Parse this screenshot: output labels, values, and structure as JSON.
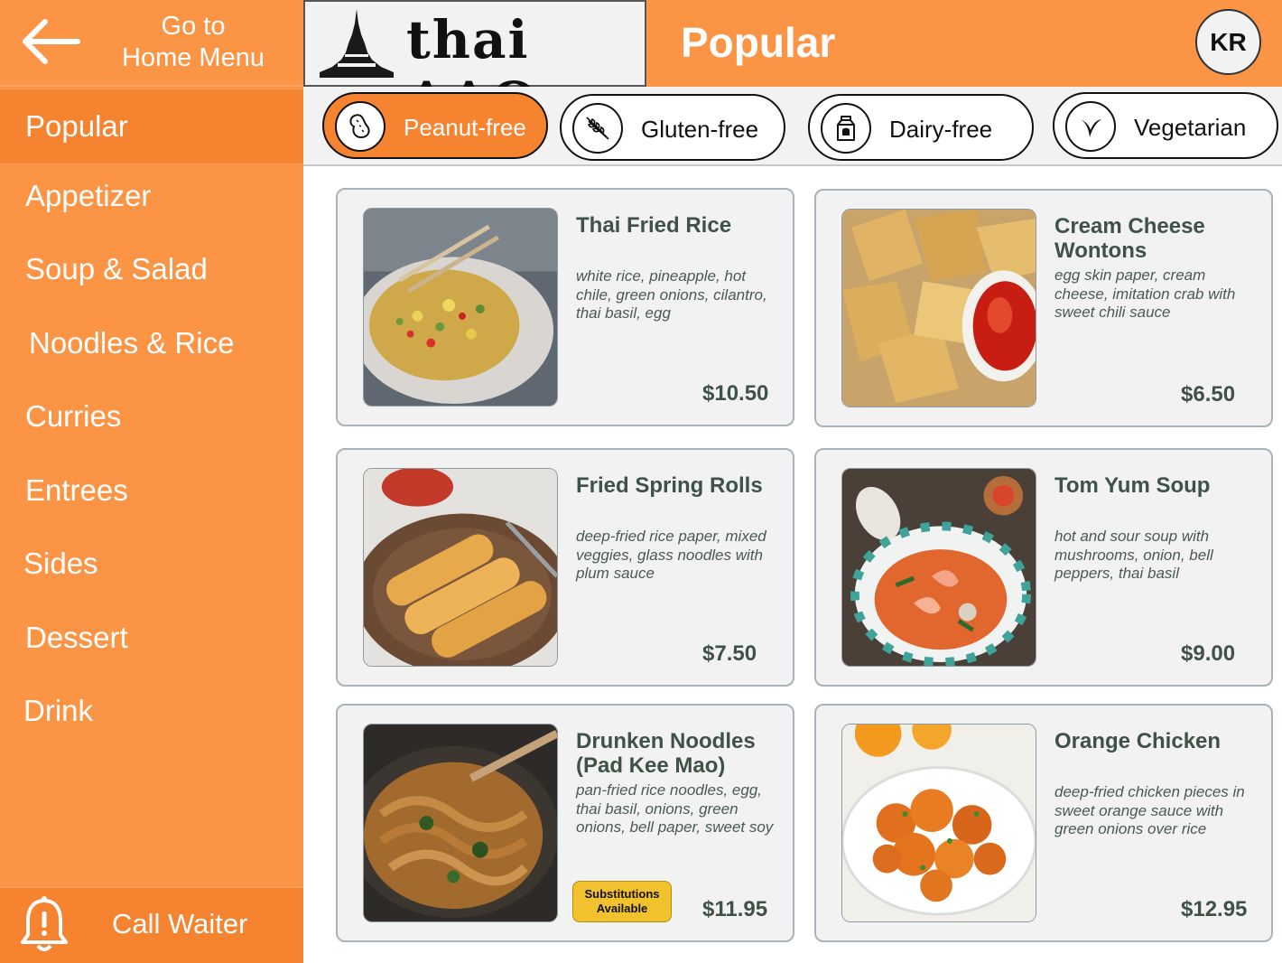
{
  "nav": {
    "back_label": "Go to\nHome Menu",
    "categories": [
      {
        "label": "Popular"
      },
      {
        "label": "Appetizer"
      },
      {
        "label": "Soup & Salad"
      },
      {
        "label": "Noodles & Rice"
      },
      {
        "label": "Curries"
      },
      {
        "label": "Entrees"
      },
      {
        "label": "Sides"
      },
      {
        "label": "Dessert"
      },
      {
        "label": "Drink"
      }
    ],
    "active_category": "Popular",
    "call_waiter_label": "Call Waiter"
  },
  "header": {
    "logo_text": "thai ɅɅO",
    "title": "Popular",
    "user_initials": "KR"
  },
  "filters": [
    {
      "label": "Peanut-free",
      "icon": "peanut-icon",
      "active": true
    },
    {
      "label": "Gluten-free",
      "icon": "wheat-icon",
      "active": false
    },
    {
      "label": "Dairy-free",
      "icon": "milk-carton-icon",
      "active": false
    },
    {
      "label": "Vegetarian",
      "icon": "leaf-icon",
      "active": false
    }
  ],
  "menu_items": [
    {
      "name": "Thai Fried Rice",
      "description": "white rice, pineapple, hot chile, green onions, cilantro, thai basil, egg",
      "price": "$10.50"
    },
    {
      "name": "Cream Cheese Wontons",
      "description": "egg skin paper, cream cheese, imitation crab with sweet chili sauce",
      "price": "$6.50"
    },
    {
      "name": "Fried Spring Rolls",
      "description": "deep-fried rice paper, mixed veggies, glass noodles with plum sauce",
      "price": "$7.50"
    },
    {
      "name": "Tom Yum Soup",
      "description": "hot and sour soup with mushrooms, onion, bell peppers, thai basil",
      "price": "$9.00"
    },
    {
      "name": "Drunken Noodles (Pad Kee Mao)",
      "description": "pan-fried rice noodles, egg, thai basil, onions, green onions, bell paper, sweet soy",
      "price": "$11.95",
      "badge": "Substitutions Available"
    },
    {
      "name": "Orange Chicken",
      "description": "deep-fried chicken pieces in sweet orange sauce with green onions over rice",
      "price": "$12.95"
    }
  ],
  "colors": {
    "brand_orange": "#fb9445",
    "active_orange": "#f5832f",
    "card_bg": "#f2f2f2",
    "text_green": "#3f5247",
    "badge_yellow": "#f2c12e"
  }
}
